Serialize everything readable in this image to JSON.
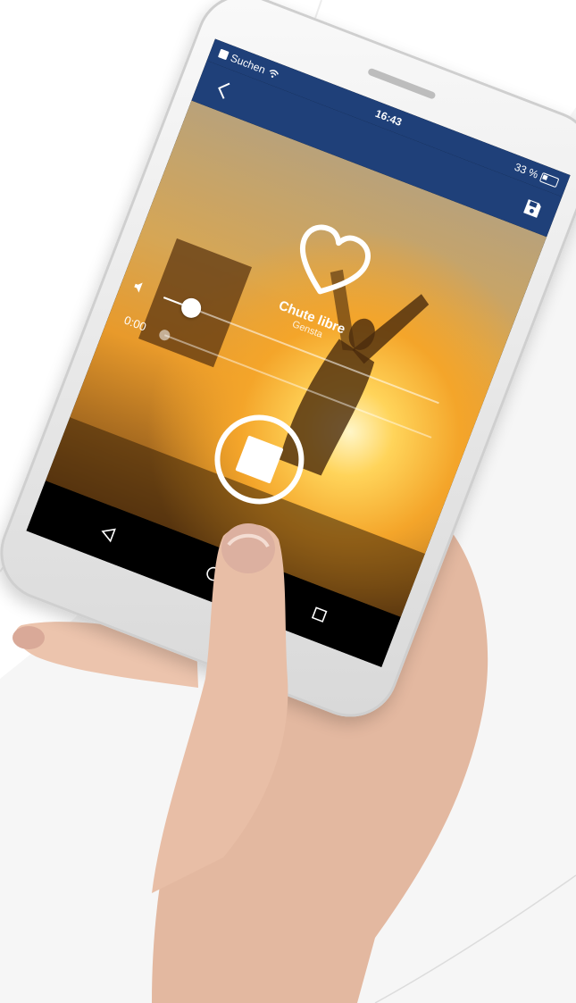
{
  "status_bar": {
    "carrier": "Suchen",
    "time": "16:43",
    "battery": "33 %"
  },
  "app_bar": {
    "back_icon": "chevron-left-icon",
    "save_icon": "floppy-disk-icon",
    "color": "#1f4079"
  },
  "player": {
    "favorite_icon": "heart-outline-icon",
    "title": "Chute libre",
    "artist": "Gensta",
    "volume_level": 0.1,
    "elapsed": "0:00",
    "progress": 0.0,
    "stop_icon": "stop-icon"
  },
  "nav_bar": {
    "back_icon": "triangle-back-icon",
    "home_icon": "circle-home-icon",
    "recents_icon": "square-recents-icon"
  }
}
